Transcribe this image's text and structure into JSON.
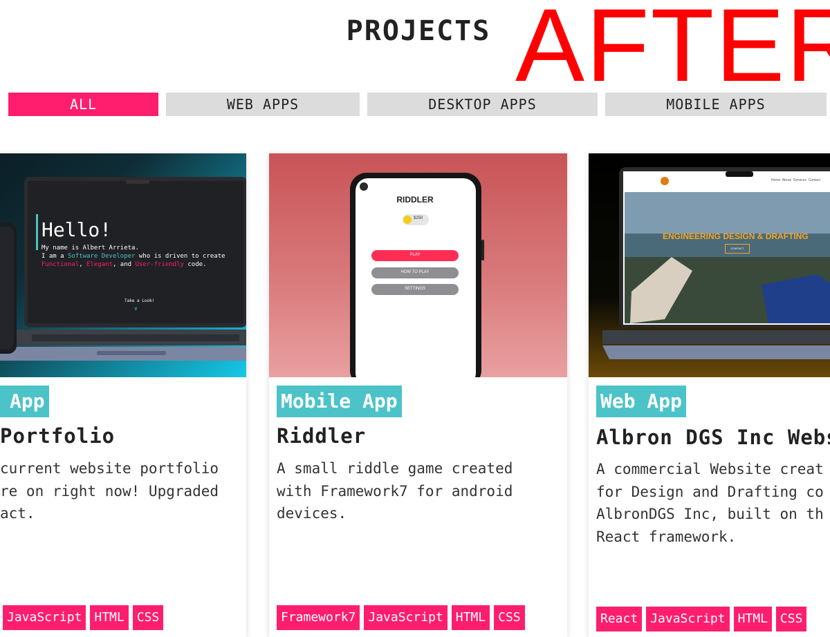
{
  "header": {
    "title": "PROJECTS",
    "overlay_label": "AFTER"
  },
  "filters": [
    {
      "label": "ALL",
      "active": true
    },
    {
      "label": "WEB APPS",
      "active": false
    },
    {
      "label": "DESKTOP APPS",
      "active": false
    },
    {
      "label": "MOBILE APPS",
      "active": false
    }
  ],
  "cards": [
    {
      "category": "Web App",
      "category_visible": "App",
      "title_visible": "Portfolio",
      "description_visible": "current website portfolio\nre on right now! Upgraded\nact.",
      "tags": [
        "JavaScript",
        "HTML",
        "CSS"
      ],
      "screen": {
        "heading": "Hello!",
        "line1": "My name is Albert Arrieta.",
        "line2a": "I am a ",
        "line2b": "Software Developer",
        "line2c": " who is driven to create",
        "line3a": "Functional",
        "line3b": ", ",
        "line3c": "Elegant",
        "line3d": ", and ",
        "line3e": "User-friendly",
        "line3f": " code.",
        "cta": "Take a Look!"
      }
    },
    {
      "category": "Mobile App",
      "title": "Riddler",
      "description": "A small riddle game created\nwith Framework7 for android\ndevices.",
      "tags": [
        "Framework7",
        "JavaScript",
        "HTML",
        "CSS"
      ],
      "screen": {
        "app_title": "RIDDLER",
        "coins": "$250",
        "play": "PLAY",
        "how_to_play": "HOW TO PLAY",
        "settings": "SETTINGS"
      }
    },
    {
      "category": "Web App",
      "title_visible": "Albron DGS Inc Webs",
      "description_visible": "A commercial Website creat\nfor Design and Drafting co\nAlbronDGS Inc, built on th\nReact framework.",
      "tags": [
        "React",
        "JavaScript",
        "HTML",
        "CSS"
      ],
      "screen": {
        "hero": "ENGINEERING DESIGN & DRAFTING",
        "nav": "Home  About  Services  Contact",
        "contact": "CONTACT"
      }
    }
  ],
  "colors": {
    "accent": "#ff1e6e",
    "teal": "#4cc3c8",
    "after_red": "#ff0000"
  }
}
